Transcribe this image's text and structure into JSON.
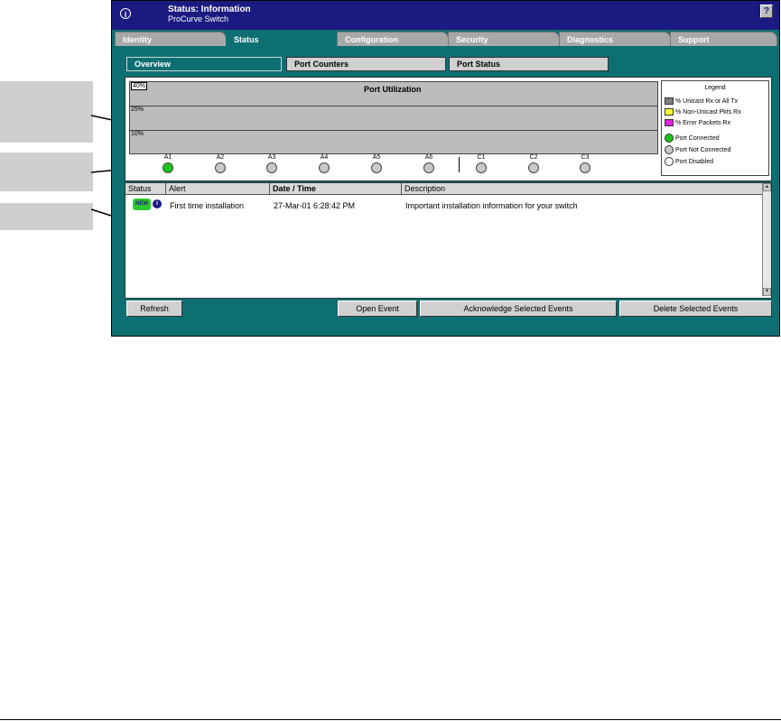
{
  "window": {
    "title": "Status: Information",
    "subtitle": "ProCurve Switch",
    "info_icon_glyph": "i",
    "help_glyph": "?"
  },
  "tabs": [
    {
      "label": "Identity",
      "active": false
    },
    {
      "label": "Status",
      "active": true
    },
    {
      "label": "Configuration",
      "active": false
    },
    {
      "label": "Security",
      "active": false
    },
    {
      "label": "Diagnostics",
      "active": false
    },
    {
      "label": "Support",
      "active": false
    }
  ],
  "subtabs": [
    {
      "label": "Overview",
      "active": true
    },
    {
      "label": "Port Counters",
      "active": false
    },
    {
      "label": "Port Status",
      "active": false
    }
  ],
  "utilization": {
    "title": "Port Utilization",
    "scale_labels": [
      "40%",
      "25%",
      "10%"
    ],
    "ports": [
      {
        "name": "A1",
        "status": "connected"
      },
      {
        "name": "A2",
        "status": "not-connected"
      },
      {
        "name": "A3",
        "status": "not-connected"
      },
      {
        "name": "A4",
        "status": "not-connected"
      },
      {
        "name": "A5",
        "status": "not-connected"
      },
      {
        "name": "A6",
        "status": "not-connected"
      },
      {
        "name": "C1",
        "status": "not-connected"
      },
      {
        "name": "C2",
        "status": "not-connected"
      },
      {
        "name": "C3",
        "status": "not-connected"
      }
    ]
  },
  "legend": {
    "title": "Legend",
    "items": [
      {
        "label": "% Unicast Rx or All Tx",
        "color": "#7f7f7f"
      },
      {
        "label": "% Non-Unicast Pkts Rx",
        "color": "#ffff33"
      },
      {
        "label": "% Error Packets Rx",
        "color": "#e020e0"
      },
      {
        "label": "Port Connected",
        "color": "#17c617"
      },
      {
        "label": "Port Not Connected",
        "color": "#c8c8c8"
      },
      {
        "label": "Port Disabled",
        "color": "#ffffff"
      }
    ]
  },
  "events": {
    "columns": [
      "Status",
      "Alert",
      "Date / Time",
      "Description"
    ],
    "rows": [
      {
        "status_badge": "NEW",
        "alert": "First time installation",
        "datetime": "27-Mar-01 6:28:42 PM",
        "description": "Important installation information for your switch"
      }
    ]
  },
  "buttons": {
    "refresh": "Refresh",
    "open_event": "Open Event",
    "acknowledge": "Acknowledge Selected Events",
    "delete": "Delete Selected Events"
  }
}
